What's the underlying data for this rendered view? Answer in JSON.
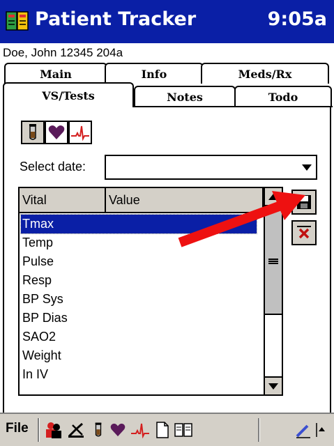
{
  "app": {
    "title": "Patient Tracker",
    "clock": "9:05a",
    "patient": "Doe, John 12345 204a"
  },
  "tabs": {
    "row1": [
      {
        "label": "Main"
      },
      {
        "label": "Info"
      },
      {
        "label": "Meds/Rx"
      }
    ],
    "row2": [
      {
        "label": "VS/Tests",
        "active": true
      },
      {
        "label": "Notes"
      },
      {
        "label": "Todo"
      }
    ]
  },
  "categories": [
    {
      "icon": "test-tube-icon"
    },
    {
      "icon": "heart-icon",
      "selected": true
    },
    {
      "icon": "ecg-icon"
    }
  ],
  "date_select": {
    "label": "Select date:",
    "value": ""
  },
  "table": {
    "columns": [
      "Vital",
      "Value"
    ],
    "rows": [
      {
        "vital": "Tmax",
        "value": "",
        "selected": true
      },
      {
        "vital": "Temp",
        "value": ""
      },
      {
        "vital": "Pulse",
        "value": ""
      },
      {
        "vital": "Resp",
        "value": ""
      },
      {
        "vital": "BP Sys",
        "value": ""
      },
      {
        "vital": "BP Dias",
        "value": ""
      },
      {
        "vital": "SAO2",
        "value": ""
      },
      {
        "vital": "Weight",
        "value": ""
      },
      {
        "vital": "In IV",
        "value": ""
      }
    ]
  },
  "side_buttons": [
    {
      "icon": "save-icon"
    },
    {
      "icon": "delete-icon"
    }
  ],
  "menubar": {
    "file_label": "File",
    "icons": [
      "patients-icon",
      "procedures-icon",
      "test-tube-icon",
      "heart-icon",
      "ecg-icon",
      "new-document-icon",
      "book-icon",
      "pen-icon",
      "input-arrow-icon"
    ]
  },
  "colors": {
    "title_bar": "#0a1fa6",
    "selection": "#0a1fa6",
    "annotation_arrow": "#ee1111",
    "heart": "#5a1a5a",
    "ecg": "#d42020"
  }
}
